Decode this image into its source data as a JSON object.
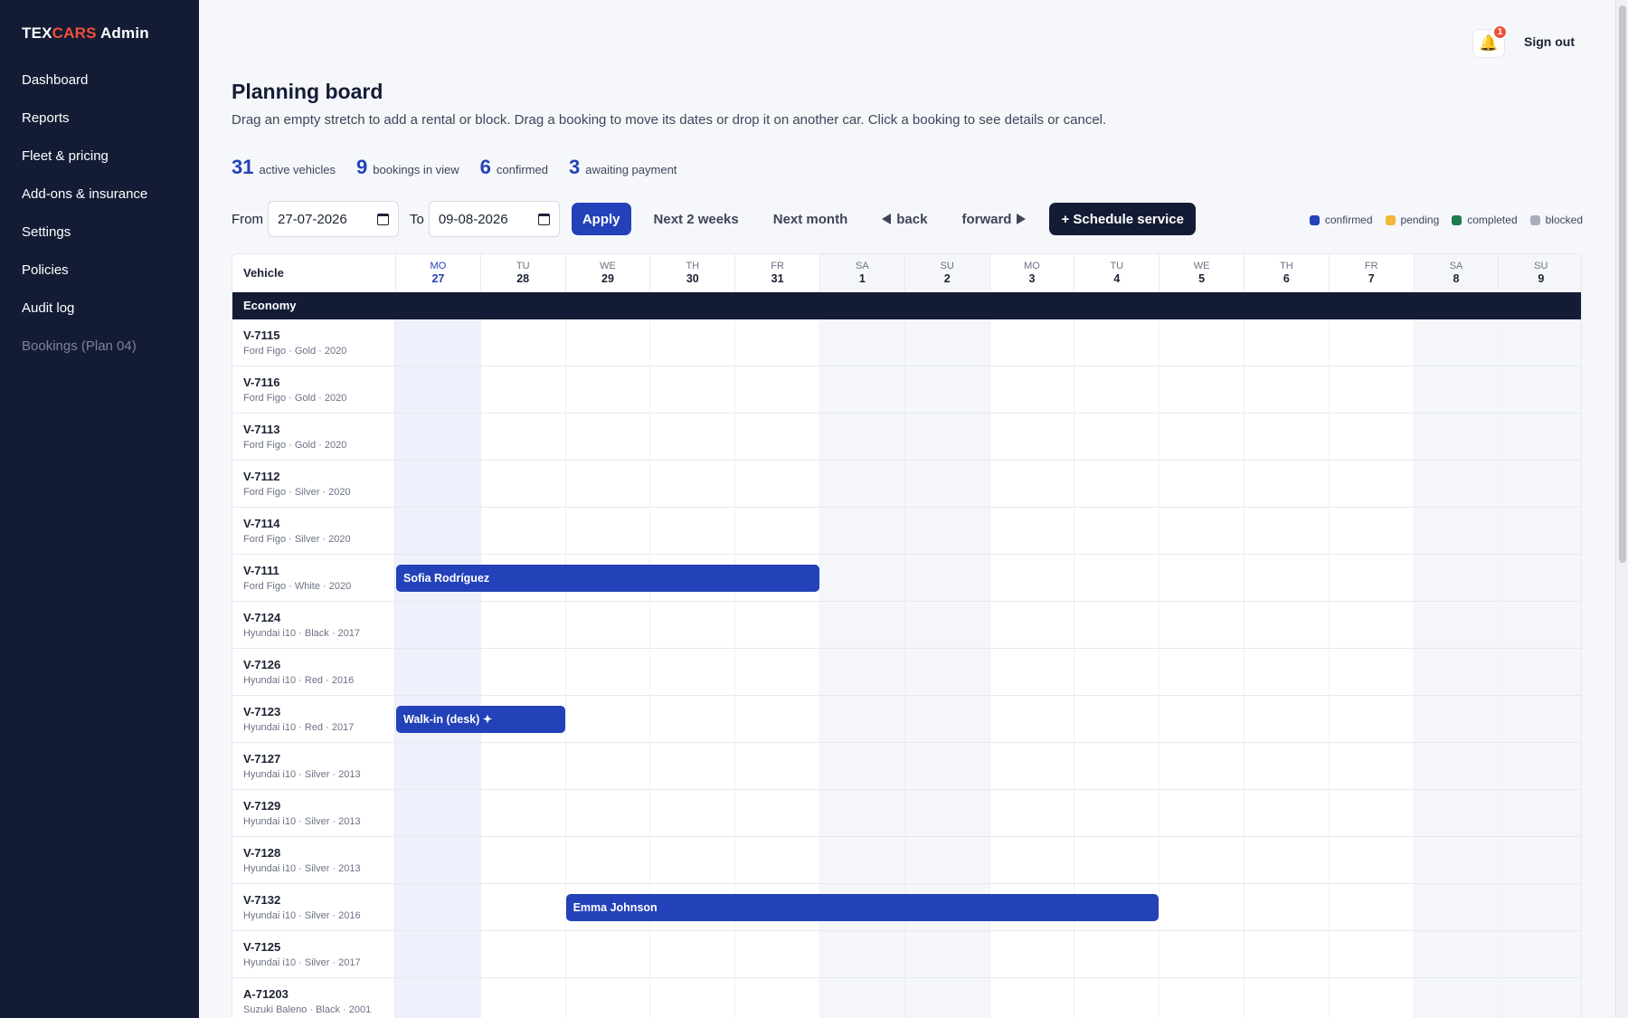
{
  "brand": {
    "part1": "TEX",
    "part2": "CARS",
    "part3": " Admin"
  },
  "nav": [
    {
      "label": "Dashboard",
      "name": "dashboard",
      "muted": false
    },
    {
      "label": "Reports",
      "name": "reports",
      "muted": false
    },
    {
      "label": "Fleet & pricing",
      "name": "fleet-pricing",
      "muted": false
    },
    {
      "label": "Add-ons & insurance",
      "name": "addons-insurance",
      "muted": false
    },
    {
      "label": "Settings",
      "name": "settings",
      "muted": false
    },
    {
      "label": "Policies",
      "name": "policies",
      "muted": false
    },
    {
      "label": "Audit log",
      "name": "audit-log",
      "muted": false
    },
    {
      "label": "Bookings (Plan 04)",
      "name": "bookings-plan",
      "muted": true
    }
  ],
  "topbar": {
    "notifications": "1",
    "signout": "Sign out",
    "bell_icon": "bell-icon"
  },
  "header": {
    "title": "Planning board",
    "subtitle": "Drag an empty stretch to add a rental or block. Drag a booking to move its dates or drop it on another car. Click a booking to see details or cancel."
  },
  "stats": [
    {
      "num": "31",
      "label": "active vehicles"
    },
    {
      "num": "9",
      "label": "bookings in view"
    },
    {
      "num": "6",
      "label": "confirmed"
    },
    {
      "num": "3",
      "label": "awaiting payment"
    }
  ],
  "toolbar": {
    "from_label": "From",
    "from_value": "27-07-2026",
    "to_label": "To",
    "to_value": "09-08-2026",
    "apply": "Apply",
    "next2": "Next 2 weeks",
    "nextmonth": "Next month",
    "back": "back",
    "forward": "forward",
    "schedule": "+ Schedule service"
  },
  "legend": [
    {
      "label": "confirmed",
      "color": "#2341b8"
    },
    {
      "label": "pending",
      "color": "#f2b63a"
    },
    {
      "label": "completed",
      "color": "#1f7a4d"
    },
    {
      "label": "blocked",
      "color": "#a7acbd"
    }
  ],
  "board": {
    "vehicle_header": "Vehicle",
    "days": [
      {
        "name": "MO",
        "num": "27",
        "today": true,
        "weekend": false
      },
      {
        "name": "TU",
        "num": "28",
        "today": false,
        "weekend": false
      },
      {
        "name": "WE",
        "num": "29",
        "today": false,
        "weekend": false
      },
      {
        "name": "TH",
        "num": "30",
        "today": false,
        "weekend": false
      },
      {
        "name": "FR",
        "num": "31",
        "today": false,
        "weekend": false
      },
      {
        "name": "SA",
        "num": "1",
        "today": false,
        "weekend": true
      },
      {
        "name": "SU",
        "num": "2",
        "today": false,
        "weekend": true
      },
      {
        "name": "MO",
        "num": "3",
        "today": false,
        "weekend": false
      },
      {
        "name": "TU",
        "num": "4",
        "today": false,
        "weekend": false
      },
      {
        "name": "WE",
        "num": "5",
        "today": false,
        "weekend": false
      },
      {
        "name": "TH",
        "num": "6",
        "today": false,
        "weekend": false
      },
      {
        "name": "FR",
        "num": "7",
        "today": false,
        "weekend": false
      },
      {
        "name": "SA",
        "num": "8",
        "today": false,
        "weekend": true
      },
      {
        "name": "SU",
        "num": "9",
        "today": false,
        "weekend": true
      }
    ],
    "group": "Economy",
    "vehicles": [
      {
        "id": "V-7115",
        "model": "Ford Figo · Gold · 2020"
      },
      {
        "id": "V-7116",
        "model": "Ford Figo · Gold · 2020"
      },
      {
        "id": "V-7113",
        "model": "Ford Figo · Gold · 2020"
      },
      {
        "id": "V-7112",
        "model": "Ford Figo · Silver · 2020"
      },
      {
        "id": "V-7114",
        "model": "Ford Figo · Silver · 2020"
      },
      {
        "id": "V-7111",
        "model": "Ford Figo · White · 2020",
        "booking": {
          "label": "Sofia Rodríguez",
          "start": 0,
          "days": 5
        }
      },
      {
        "id": "V-7124",
        "model": "Hyundai i10 · Black · 2017"
      },
      {
        "id": "V-7126",
        "model": "Hyundai i10 · Red · 2016"
      },
      {
        "id": "V-7123",
        "model": "Hyundai i10 · Red · 2017",
        "booking": {
          "label": "Walk-in (desk) ✦",
          "start": 0,
          "days": 2
        }
      },
      {
        "id": "V-7127",
        "model": "Hyundai i10 · Silver · 2013"
      },
      {
        "id": "V-7129",
        "model": "Hyundai i10 · Silver · 2013"
      },
      {
        "id": "V-7128",
        "model": "Hyundai i10 · Silver · 2013"
      },
      {
        "id": "V-7132",
        "model": "Hyundai i10 · Silver · 2016",
        "booking": {
          "label": "Emma Johnson",
          "start": 2,
          "days": 7
        }
      },
      {
        "id": "V-7125",
        "model": "Hyundai i10 · Silver · 2017"
      },
      {
        "id": "A-71203",
        "model": "Suzuki Baleno · Black · 2001"
      }
    ]
  }
}
